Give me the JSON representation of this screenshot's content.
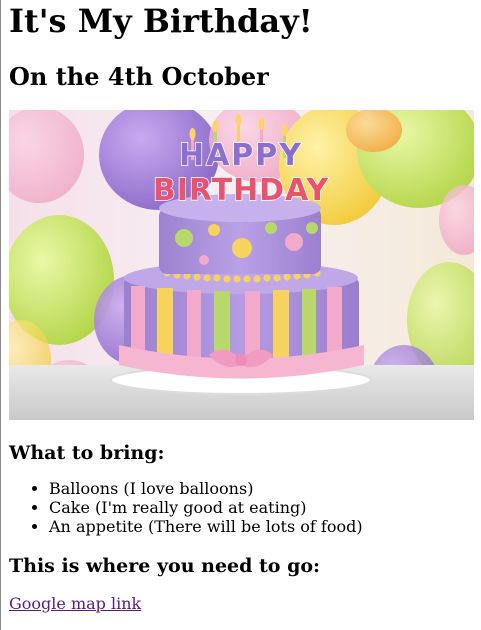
{
  "page": {
    "title": "It's My Birthday!",
    "subtitle": "On the 4th October",
    "hero_image": {
      "cake_text_top": "HAPPY",
      "cake_text_bottom": "BIRTHDAY"
    },
    "bring_heading": "What to bring:",
    "bring_items": [
      "Balloons (I love balloons)",
      "Cake (I'm really good at eating)",
      "An appetite (There will be lots of food)"
    ],
    "directions_heading": "This is where you need to go:",
    "map_link": "Google map link"
  },
  "colors": {
    "link_visited": "#551a8b",
    "cake_purple": "#a98fd6",
    "cake_pink": "#f3a9c9",
    "cake_yellow": "#f6d35c",
    "cake_green": "#b8d86b"
  }
}
